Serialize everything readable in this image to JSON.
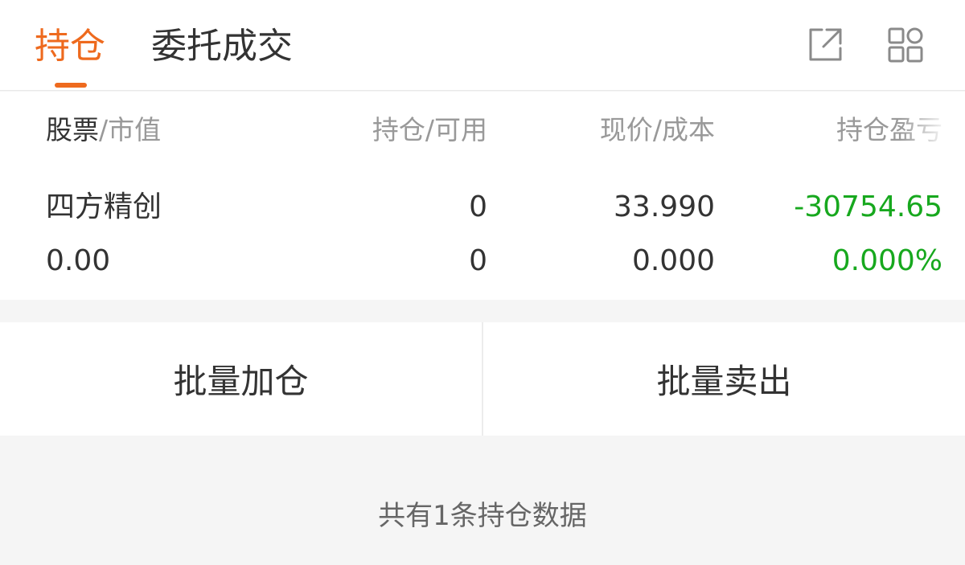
{
  "tabs": [
    {
      "label": "持仓",
      "active": true
    },
    {
      "label": "委托成交",
      "active": false
    }
  ],
  "icons": {
    "share": "share-icon",
    "apps": "apps-grid-icon"
  },
  "colors": {
    "accent": "#ee6a1e",
    "profit_negative": "#17a81e",
    "text": "#333333",
    "muted": "#999999",
    "background": "#f5f5f5"
  },
  "table": {
    "headers": {
      "stock_strong": "股票",
      "stock_rest": "/市值",
      "position": "持仓/可用",
      "price": "现价/成本",
      "pnl": "持仓盈亏"
    },
    "rows": [
      {
        "name": "四方精创",
        "market_value": "0.00",
        "position": "0",
        "available": "0",
        "current_price": "33.990",
        "cost": "0.000",
        "pnl_amount": "-30754.65",
        "pnl_percent": "0.000%"
      }
    ]
  },
  "actions": {
    "batch_add": "批量加仓",
    "batch_sell": "批量卖出"
  },
  "footer": {
    "summary": "共有1条持仓数据"
  }
}
